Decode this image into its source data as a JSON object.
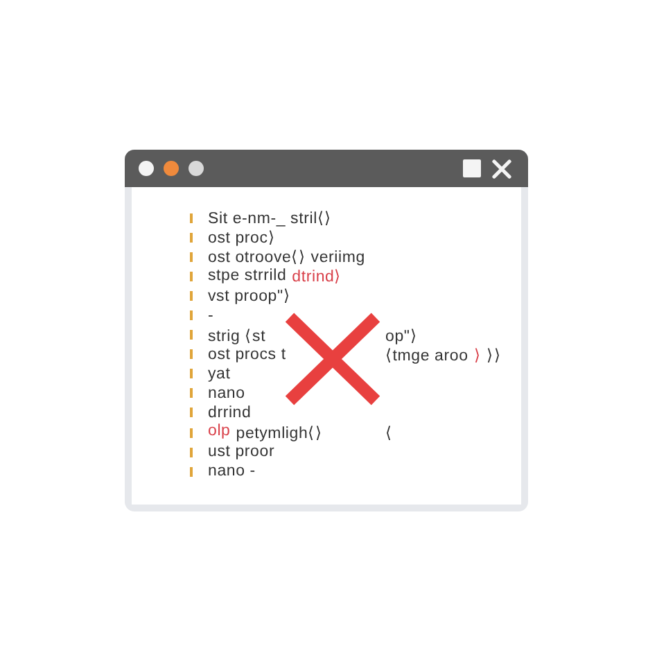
{
  "window": {
    "controls": [
      {
        "color": "#f4f4f4"
      },
      {
        "color": "#f08a3c"
      },
      {
        "color": "#d9d9d9"
      }
    ]
  },
  "code_lines": [
    {
      "segments": [
        {
          "kind": "text",
          "text": "Sit e-nm-_ stril⟨⟩"
        }
      ]
    },
    {
      "segments": [
        {
          "kind": "text",
          "text": "ost proc⟩"
        }
      ]
    },
    {
      "segments": [
        {
          "kind": "text",
          "text": "ost otroove⟨⟩ veriimg"
        }
      ]
    },
    {
      "segments": [
        {
          "kind": "text",
          "text": "stpe strrild"
        },
        {
          "kind": "keyword",
          "text": "dtrind⟩"
        }
      ]
    },
    {
      "segments": [
        {
          "kind": "text",
          "text": "vst proop\"⟩"
        }
      ]
    },
    {
      "segments": [
        {
          "kind": "text",
          "text": "-"
        }
      ]
    },
    {
      "segments": [
        {
          "kind": "text",
          "text": "strig ⟨st"
        },
        {
          "kind": "gap"
        },
        {
          "kind": "text",
          "text": "op\"⟩"
        }
      ]
    },
    {
      "segments": [
        {
          "kind": "text",
          "text": "ost procs t"
        },
        {
          "kind": "gap"
        },
        {
          "kind": "text",
          "text": "⟨tmge aroo"
        },
        {
          "kind": "keyword",
          "text": "⟩"
        },
        {
          "kind": "text",
          "text": "⟩⟩"
        }
      ]
    },
    {
      "segments": [
        {
          "kind": "text",
          "text": "yat"
        }
      ]
    },
    {
      "segments": [
        {
          "kind": "text",
          "text": "nano"
        }
      ]
    },
    {
      "segments": [
        {
          "kind": "text",
          "text": "drrind"
        }
      ]
    },
    {
      "segments": [
        {
          "kind": "keyword",
          "text": "olp"
        },
        {
          "kind": "text",
          "text": "petymligh⟨⟩"
        },
        {
          "kind": "gap"
        },
        {
          "kind": "text",
          "text": "⟨"
        }
      ]
    },
    {
      "segments": [
        {
          "kind": "text",
          "text": "ust proor"
        }
      ]
    },
    {
      "segments": [
        {
          "kind": "text",
          "text": "nano -"
        }
      ]
    }
  ]
}
